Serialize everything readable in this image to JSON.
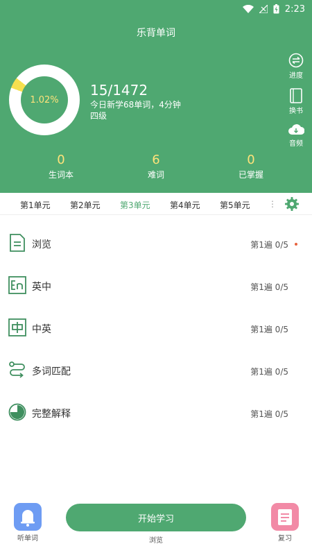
{
  "status_bar": {
    "time": "2:23",
    "icons": [
      "wifi-icon",
      "no-signal-icon",
      "battery-charging-icon"
    ]
  },
  "app": {
    "title": "乐背单词"
  },
  "progress": {
    "percent_label": "1.02%",
    "ring_fraction": 0.0102,
    "count": "15/1472",
    "today_summary": "今日新学68单词，4分钟",
    "level": "四级"
  },
  "side_actions": [
    {
      "label": "进度",
      "icon": "progress-icon"
    },
    {
      "label": "换书",
      "icon": "book-icon"
    },
    {
      "label": "音频",
      "icon": "audio-download-icon"
    }
  ],
  "stats": [
    {
      "value": "0",
      "label": "生词本"
    },
    {
      "value": "6",
      "label": "难词"
    },
    {
      "value": "0",
      "label": "已掌握"
    }
  ],
  "units": {
    "tabs": [
      "第1单元",
      "第2单元",
      "第3单元",
      "第4单元",
      "第5单元"
    ],
    "active_index": 2,
    "more_glyph": "⋮"
  },
  "modes": [
    {
      "label": "浏览",
      "week": "第1遍 0/5",
      "icon": "document-icon",
      "has_dot": true
    },
    {
      "label": "英中",
      "week": "第1遍 0/5",
      "icon": "en-icon",
      "has_dot": false
    },
    {
      "label": "中英",
      "week": "第1遍 0/5",
      "icon": "zh-icon",
      "has_dot": false
    },
    {
      "label": "多词匹配",
      "week": "第1遍 0/5",
      "icon": "match-route-icon",
      "has_dot": false
    },
    {
      "label": "完整解释",
      "week": "第1遍 0/5",
      "icon": "pie-icon",
      "has_dot": false
    }
  ],
  "bottom_bar": {
    "listen_label": "听单词",
    "start_label": "开始学习",
    "browse_label": "浏览",
    "review_label": "复习"
  },
  "colors": {
    "primary_green": "#4fa871",
    "accent_yellow": "#ffe37a",
    "ring_progress": "#f5e04f",
    "dot_red": "#e7623e",
    "listen_blue": "#6e9cf3",
    "review_pink": "#f28aa6"
  }
}
